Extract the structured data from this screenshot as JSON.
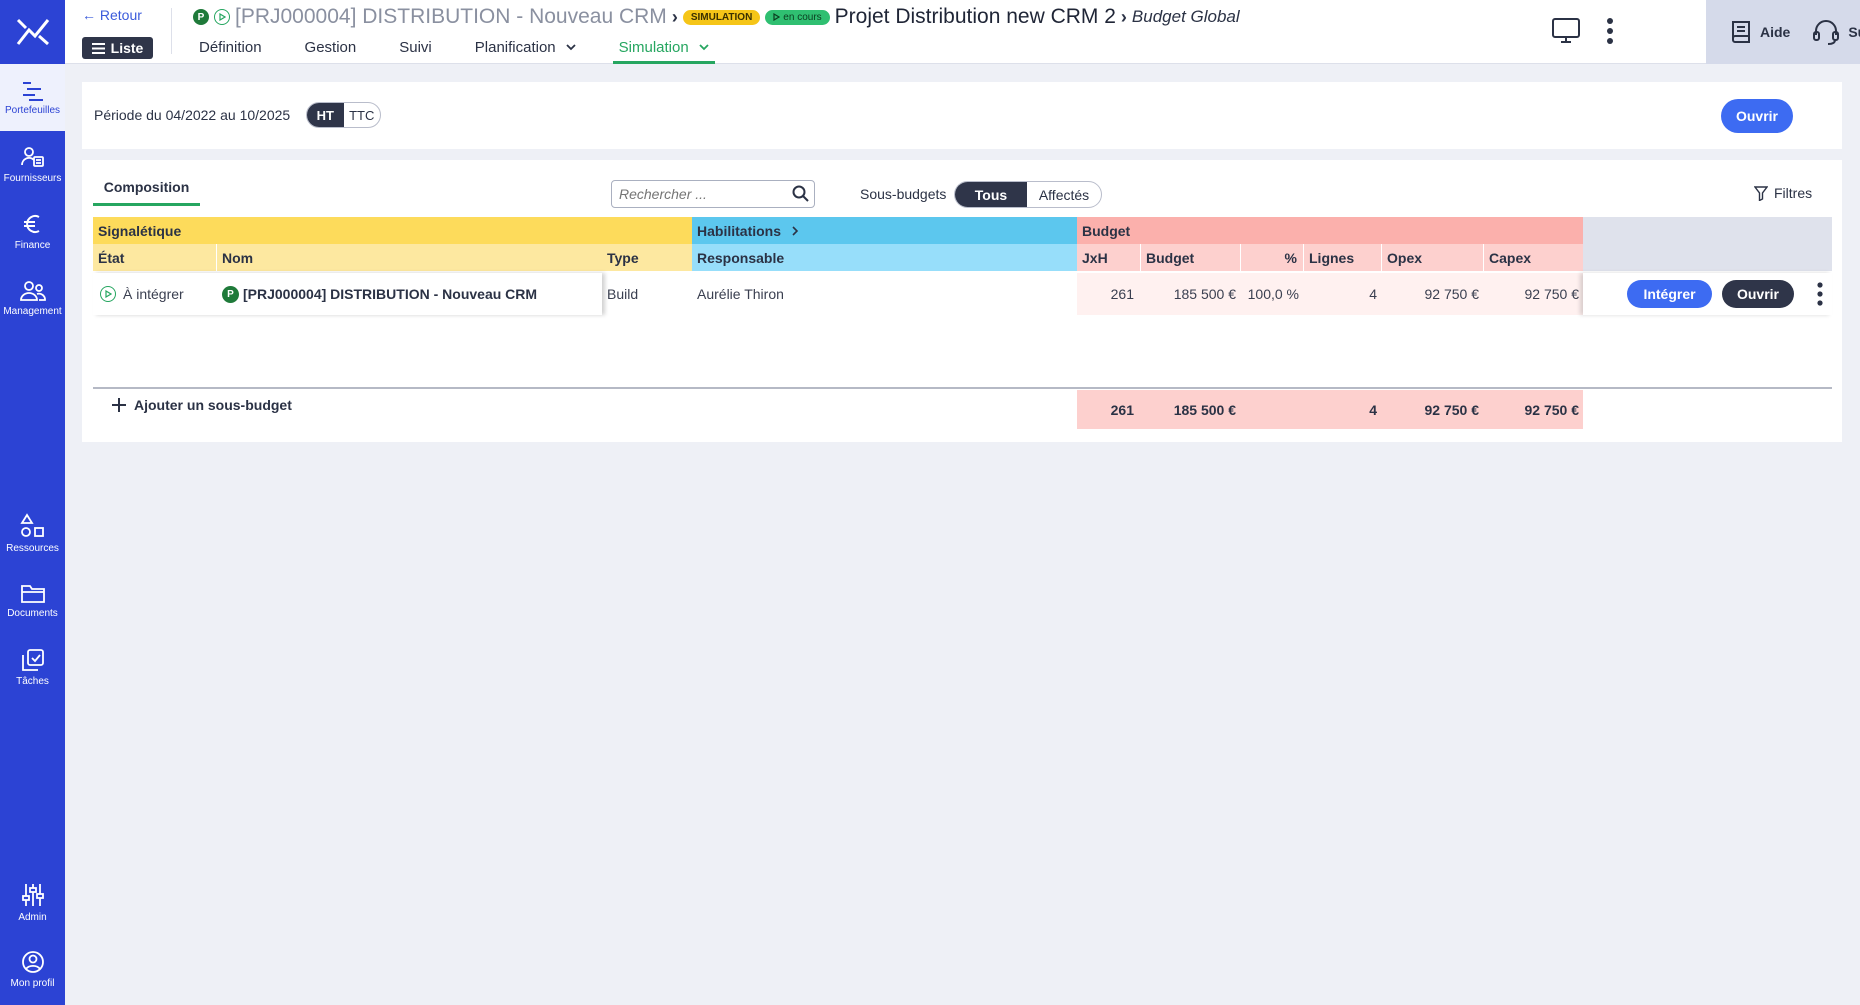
{
  "colors": {
    "sidebar": "#2c43d4",
    "accent_green": "#26a660",
    "primary_blue": "#3d6bf2",
    "dark": "#2f3549"
  },
  "sidebar": {
    "logo_icon": "brand-logo-icon",
    "items": [
      {
        "label": "Portefeuilles",
        "icon": "portfolio-icon"
      },
      {
        "label": "Fournisseurs",
        "icon": "supplier-icon"
      },
      {
        "label": "Finance",
        "icon": "euro-icon"
      },
      {
        "label": "Management",
        "icon": "people-icon"
      },
      {
        "label": "Ressources",
        "icon": "shapes-icon"
      },
      {
        "label": "Documents",
        "icon": "folder-icon"
      },
      {
        "label": "Tâches",
        "icon": "tasks-icon"
      },
      {
        "label": "Admin",
        "icon": "sliders-icon"
      },
      {
        "label": "Mon profil",
        "icon": "profile-icon"
      }
    ]
  },
  "topbar": {
    "back_label": "← Retour",
    "list_label": "Liste",
    "breadcrumb": {
      "p_badge": "P",
      "project": "[PRJ000004] DISTRIBUTION - Nouveau CRM",
      "sim_tag": "SIMULATION",
      "run_tag": "en cours",
      "simulation_name": "Projet Distribution new CRM 2",
      "page": "Budget Global"
    },
    "tabs": [
      "Définition",
      "Gestion",
      "Suivi",
      "Planification",
      "Simulation"
    ],
    "help_label": "Aide",
    "support_label": "Support"
  },
  "period": {
    "label": "Période du 04/2022 au 10/2025",
    "ht": "HT",
    "ttc": "TTC",
    "open_label": "Ouvrir"
  },
  "composition": {
    "tab_label": "Composition",
    "search_placeholder": "Rechercher ...",
    "subbudget_label": "Sous-budgets",
    "seg_all": "Tous",
    "seg_assigned": "Affectés",
    "filters_label": "Filtres",
    "groups": {
      "signaletique": "Signalétique",
      "habilitations": "Habilitations",
      "budget": "Budget"
    },
    "headers": {
      "etat": "État",
      "nom": "Nom",
      "type": "Type",
      "responsable": "Responsable",
      "jxh": "JxH",
      "budget": "Budget",
      "pct": "%",
      "lignes": "Lignes",
      "opex": "Opex",
      "capex": "Capex"
    },
    "rows": [
      {
        "etat": "À intégrer",
        "p_badge": "P",
        "nom": "[PRJ000004] DISTRIBUTION - Nouveau CRM",
        "type": "Build",
        "responsable": "Aurélie Thiron",
        "jxh": "261",
        "budget": "185 500 €",
        "pct": "100,0 %",
        "lignes": "4",
        "opex": "92 750 €",
        "capex": "92 750 €",
        "integrate_label": "Intégrer",
        "open_label": "Ouvrir"
      }
    ],
    "add_label": "Ajouter un sous-budget",
    "totals": {
      "jxh": "261",
      "budget": "185 500 €",
      "lignes": "4",
      "opex": "92 750 €",
      "capex": "92 750 €"
    }
  }
}
